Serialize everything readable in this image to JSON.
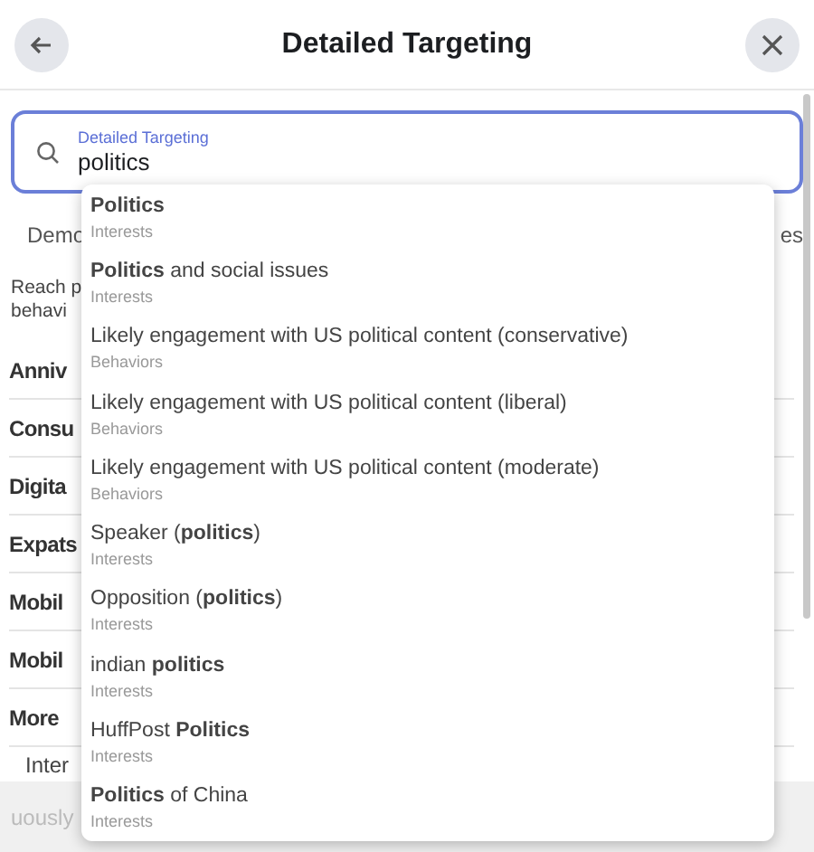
{
  "header": {
    "title": "Detailed Targeting"
  },
  "search": {
    "label": "Detailed Targeting",
    "value": "politics"
  },
  "tabs": [
    "Demo",
    "es"
  ],
  "description": [
    "Reach p",
    "behavi"
  ],
  "categories": [
    "Anniv",
    "Consu",
    "Digita",
    "Expats",
    "Mobil",
    "Mobil",
    "More"
  ],
  "subcategory": "Inter",
  "footer": {
    "text": "uously"
  },
  "suggestions": [
    {
      "title": "**Politics**",
      "type": "Interests"
    },
    {
      "title": "**Politics** and social issues",
      "type": "Interests"
    },
    {
      "title": "Likely engagement with US political content (conservative)",
      "type": "Behaviors"
    },
    {
      "title": "Likely engagement with US political content (liberal)",
      "type": "Behaviors"
    },
    {
      "title": "Likely engagement with US political content (moderate)",
      "type": "Behaviors"
    },
    {
      "title": "Speaker (**politics**)",
      "type": "Interests"
    },
    {
      "title": "Opposition (**politics**)",
      "type": "Interests"
    },
    {
      "title": "indian **politics**",
      "type": "Interests"
    },
    {
      "title": "HuffPost **Politics**",
      "type": "Interests"
    },
    {
      "title": "**Politics** of China",
      "type": "Interests"
    }
  ]
}
